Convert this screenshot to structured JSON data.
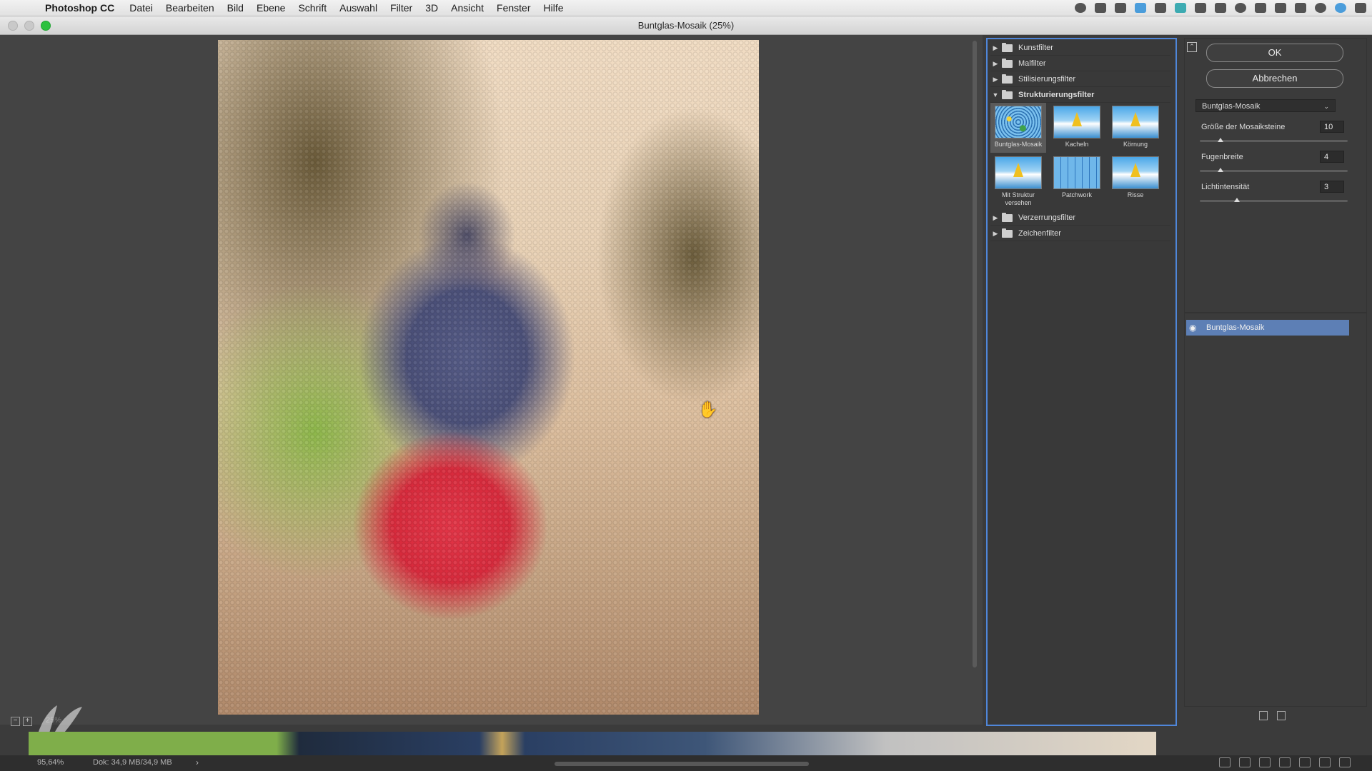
{
  "menubar": {
    "app_name": "Photoshop CC",
    "items": [
      "Datei",
      "Bearbeiten",
      "Bild",
      "Ebene",
      "Schrift",
      "Auswahl",
      "Filter",
      "3D",
      "Ansicht",
      "Fenster",
      "Hilfe"
    ]
  },
  "window": {
    "title": "Buntglas-Mosaik (25%)"
  },
  "preview": {
    "zoom_label": "25%"
  },
  "filter_gallery": {
    "categories": [
      {
        "label": "Kunstfilter",
        "open": false
      },
      {
        "label": "Malfilter",
        "open": false
      },
      {
        "label": "Stilisierungsfilter",
        "open": false
      },
      {
        "label": "Strukturierungsfilter",
        "open": true
      },
      {
        "label": "Verzerrungsfilter",
        "open": false
      },
      {
        "label": "Zeichenfilter",
        "open": false
      }
    ],
    "thumbnails": [
      {
        "label": "Buntglas-Mosaik",
        "selected": true
      },
      {
        "label": "Kacheln",
        "selected": false
      },
      {
        "label": "Körnung",
        "selected": false
      },
      {
        "label": "Mit Struktur versehen",
        "selected": false
      },
      {
        "label": "Patchwork",
        "selected": false
      },
      {
        "label": "Risse",
        "selected": false
      }
    ]
  },
  "dialog": {
    "ok_label": "OK",
    "cancel_label": "Abbrechen",
    "filter_select": "Buntglas-Mosaik",
    "params": [
      {
        "label": "Größe der Mosaiksteine",
        "value": "10",
        "fraction": 0.14
      },
      {
        "label": "Fugenbreite",
        "value": "4",
        "fraction": 0.14
      },
      {
        "label": "Lichtintensität",
        "value": "3",
        "fraction": 0.25
      }
    ]
  },
  "effect_layers": {
    "items": [
      {
        "label": "Buntglas-Mosaik",
        "visible": true
      }
    ]
  },
  "statusbar": {
    "zoom": "95,64%",
    "doc_info": "Dok: 34,9 MB/34,9 MB",
    "arrow": "›"
  },
  "colors": {
    "panel_border": "#4f86d9",
    "selected_layer": "#5d7fb5",
    "zoom_button": "#2cc13f"
  }
}
